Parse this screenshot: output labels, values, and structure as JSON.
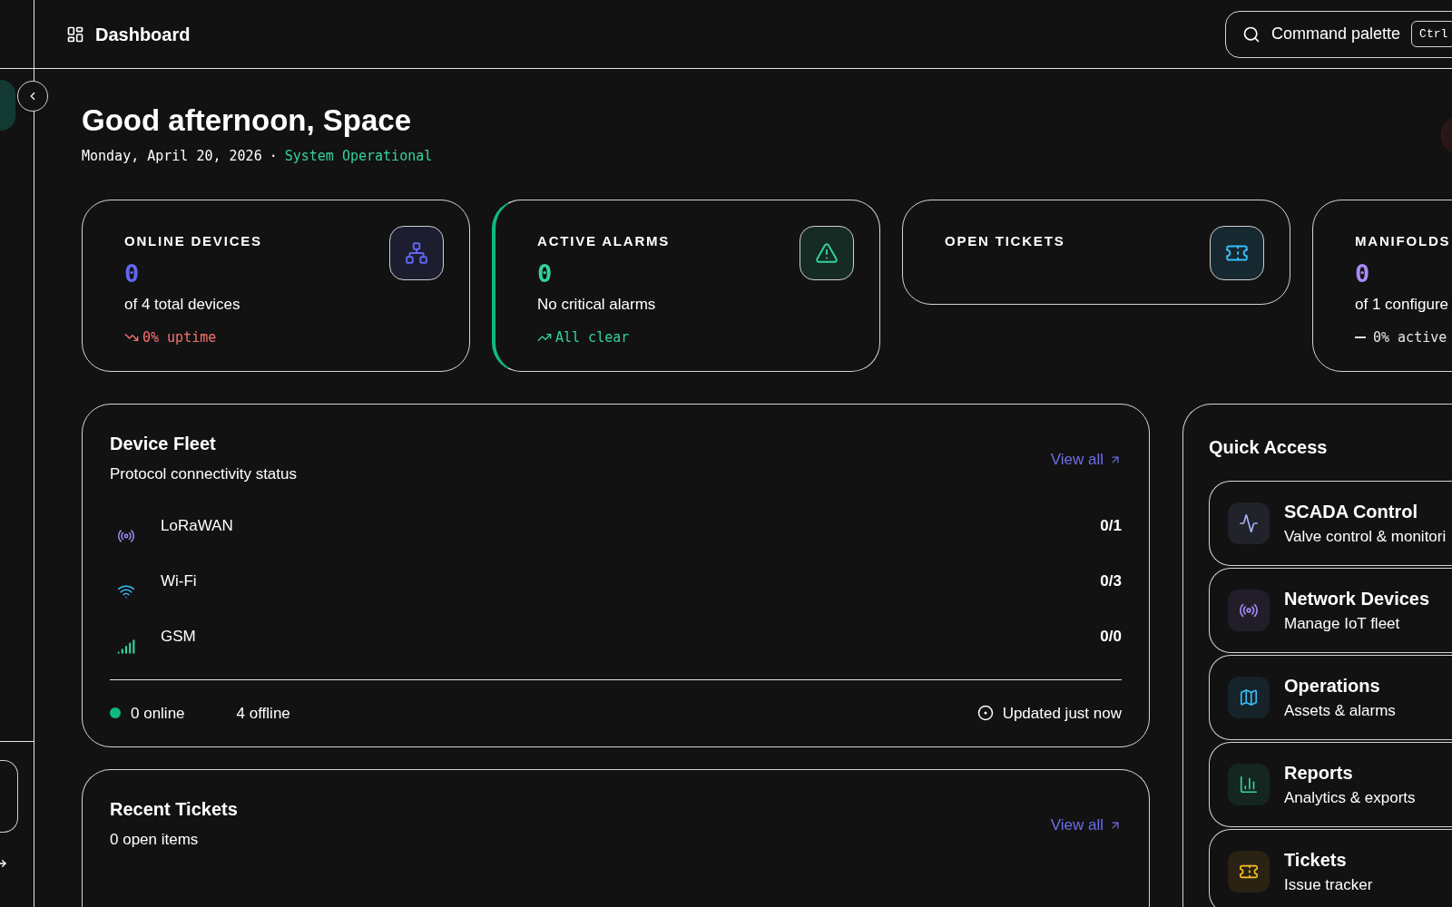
{
  "header": {
    "title": "Dashboard",
    "command": {
      "label": "Command palette",
      "shortcut": "Ctrl"
    }
  },
  "greeting": {
    "title": "Good afternoon, Space",
    "date": "Monday, April 20, 2026",
    "separator": "·",
    "status": "System Operational"
  },
  "stats": [
    {
      "label": "ONLINE DEVICES",
      "value": "0",
      "detail": "of 4 total devices",
      "trend": {
        "kind": "down",
        "text": "0% uptime"
      },
      "kind": "network",
      "color": "#6366f1",
      "accent": false
    },
    {
      "label": "ACTIVE ALARMS",
      "value": "0",
      "detail": "No critical alarms",
      "trend": {
        "kind": "up",
        "text": "All clear"
      },
      "kind": "alert",
      "color": "#34d399",
      "accent": true
    },
    {
      "label": "OPEN TICKETS",
      "kind": "ticket",
      "color": "#38bdf8",
      "accent": false
    },
    {
      "label": "MANIFOLDS",
      "value": "0",
      "detail": "of 1 configure",
      "trend": {
        "kind": "flat",
        "text": "0% active"
      },
      "color": "#a78bfa",
      "accent": false
    }
  ],
  "fleet": {
    "title": "Device Fleet",
    "subtitle": "Protocol connectivity status",
    "link": "View all",
    "protocols": [
      {
        "name": "LoRaWAN",
        "value": "0/1",
        "kind": "radio",
        "color": "#a78bfa"
      },
      {
        "name": "Wi-Fi",
        "value": "0/3",
        "kind": "wifi",
        "color": "#38bdf8"
      },
      {
        "name": "GSM",
        "value": "0/0",
        "kind": "signal",
        "color": "#34d399"
      }
    ],
    "online": {
      "text": "0 online",
      "color": "#10b981"
    },
    "offline": "4 offline",
    "updated": "Updated just now"
  },
  "tickets": {
    "title": "Recent Tickets",
    "subtitle": "0 open items",
    "link": "View all"
  },
  "quick_access": {
    "title": "Quick Access",
    "items": [
      {
        "title": "SCADA Control",
        "subtitle": "Valve control & monitori",
        "kind": "activity",
        "color": "#a5b4fc"
      },
      {
        "title": "Network Devices",
        "subtitle": "Manage IoT fleet",
        "kind": "radio",
        "color": "#a78bfa"
      },
      {
        "title": "Operations",
        "subtitle": "Assets & alarms",
        "kind": "map",
        "color": "#38bdf8"
      },
      {
        "title": "Reports",
        "subtitle": "Analytics & exports",
        "kind": "chart",
        "color": "#34d399"
      },
      {
        "title": "Tickets",
        "subtitle": "Issue tracker",
        "kind": "ticket",
        "color": "#fbbf24"
      }
    ]
  }
}
